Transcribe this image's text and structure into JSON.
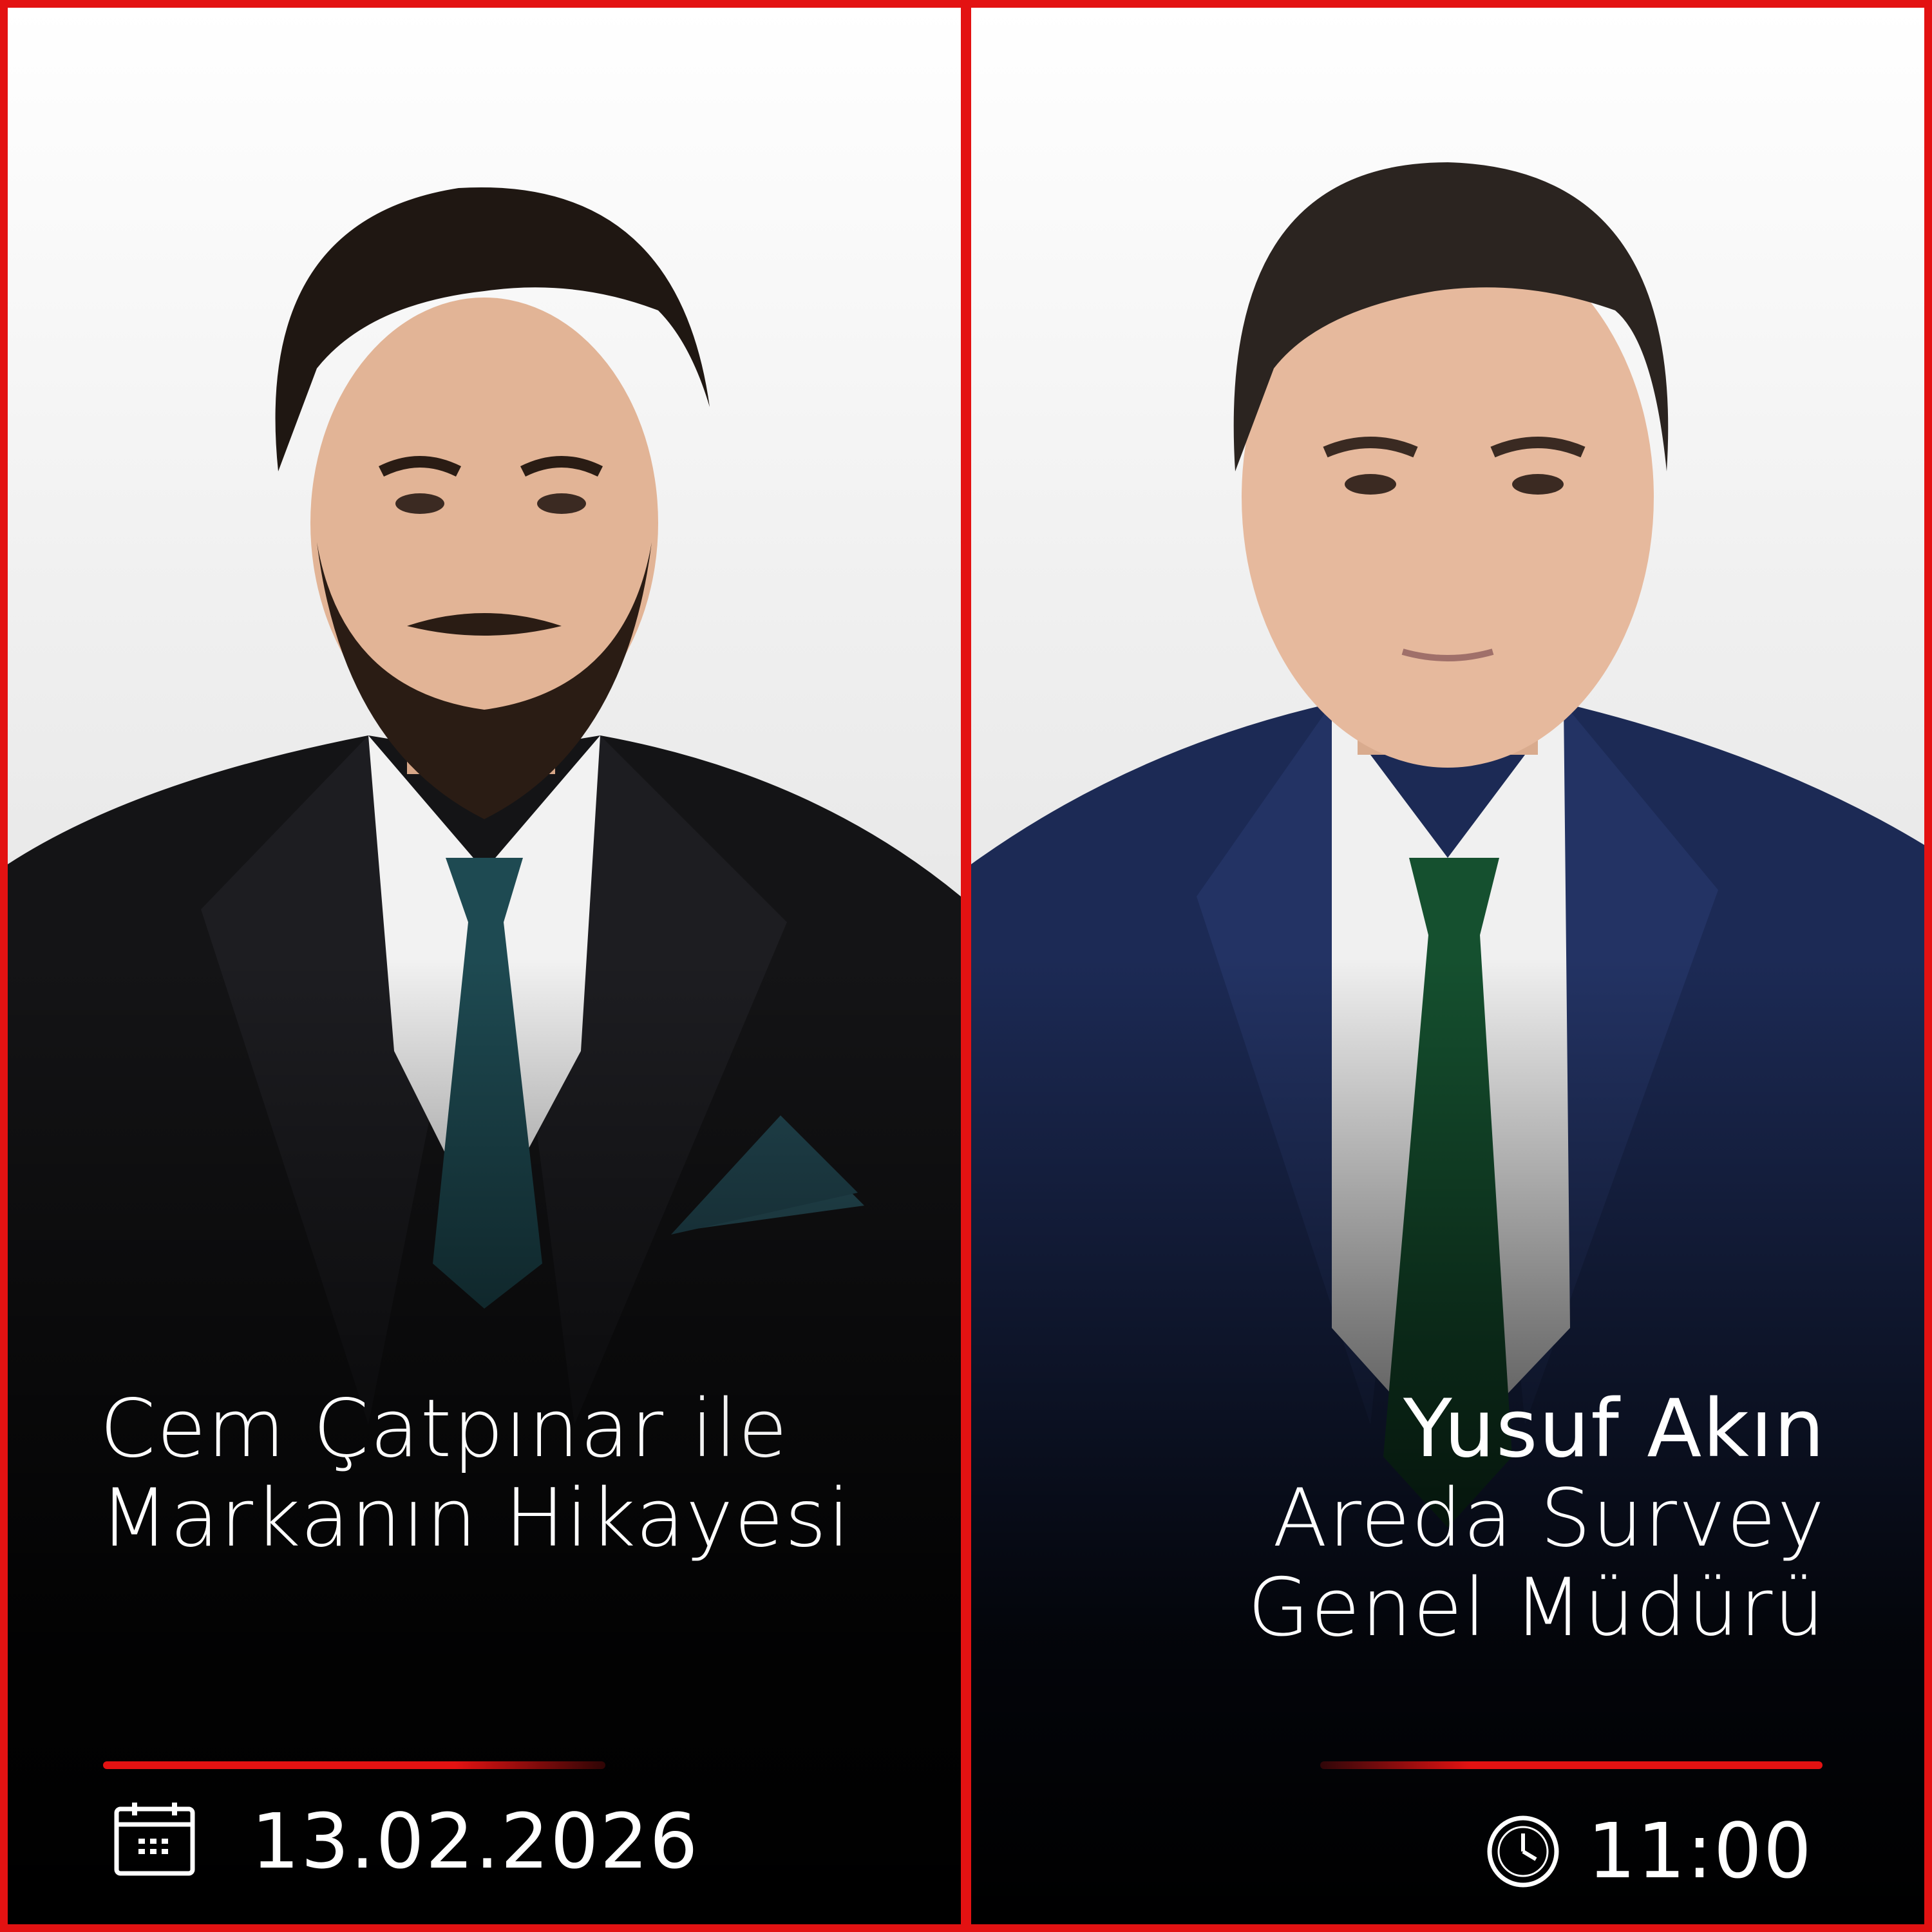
{
  "colors": {
    "accent": "#e31212",
    "text": "#ffffff"
  },
  "left": {
    "name": "Cem Çatpınar",
    "connector": "ile",
    "title_line2": "Markanın Hikayesi",
    "date": "13.02.2026",
    "icon": "calendar-icon"
  },
  "right": {
    "name": "Yusuf Akın",
    "company": "Areda Survey",
    "role": "Genel Müdürü",
    "time": "11:00",
    "icon": "clock-icon"
  }
}
